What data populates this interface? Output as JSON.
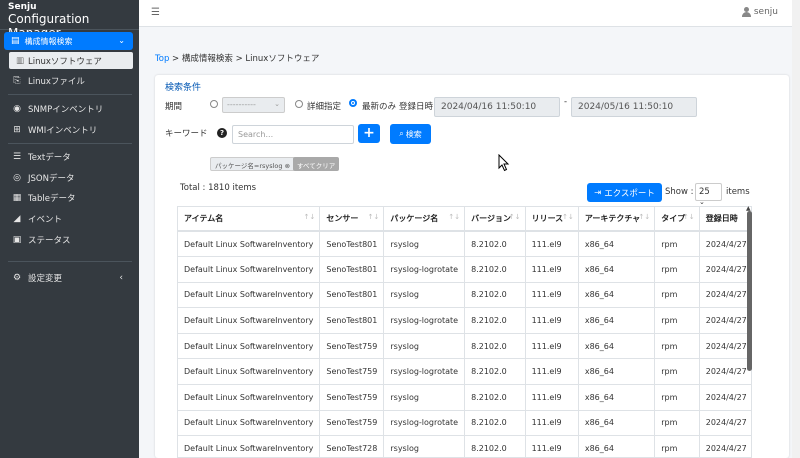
{
  "app": {
    "brand_line1": "Senju",
    "brand_line2": "Configuration Manager"
  },
  "sidebar": {
    "active_group": "構成情報検索",
    "active_sub": "Linuxソフトウェア",
    "items": [
      {
        "label": "Linuxファイル",
        "icon": "file-icon"
      },
      {
        "label": "SNMPインベントリ",
        "icon": "snmp-icon"
      },
      {
        "label": "WMIインベントリ",
        "icon": "windows-icon"
      },
      {
        "label": "Textデータ",
        "icon": "text-icon"
      },
      {
        "label": "JSONデータ",
        "icon": "json-icon"
      },
      {
        "label": "Tableデータ",
        "icon": "table-icon"
      },
      {
        "label": "イベント",
        "icon": "event-icon"
      },
      {
        "label": "ステータス",
        "icon": "status-icon"
      },
      {
        "label": "設定変更",
        "icon": "settings-icon"
      }
    ]
  },
  "topbar": {
    "user": "senju"
  },
  "breadcrumb": {
    "top": "Top",
    "level1": "構成情報検索",
    "level2": "Linuxソフトウェア"
  },
  "search": {
    "title": "検索条件",
    "period_label": "期間",
    "period_select": "----------",
    "detail_label": "詳細指定",
    "latest_label": "最新のみ",
    "registered_label": "登録日時",
    "date_from": "2024/04/16 11:50:10",
    "date_to": "2024/05/16 11:50:10",
    "date_sep": "-",
    "keyword_label": "キーワード",
    "keyword_placeholder": "Search...",
    "add_label": "+",
    "search_button": "検索",
    "chip": "パッケージ名=rsyslog",
    "clear_all": "すべてクリア"
  },
  "results": {
    "total": "Total : 1810 items",
    "export_button": "エクスポート",
    "show_label": "Show :",
    "page_size": "25",
    "items_label": "items"
  },
  "table": {
    "columns": [
      "アイテム名",
      "センサー",
      "パッケージ名",
      "バージョン",
      "リリース",
      "アーキテクチャ",
      "タイプ",
      "登録日時"
    ],
    "rows": [
      [
        "Default Linux SoftwareInventory",
        "SenoTest801",
        "rsyslog",
        "8.2102.0",
        "111.el9",
        "x86_64",
        "rpm",
        "2024/4/27"
      ],
      [
        "Default Linux SoftwareInventory",
        "SenoTest801",
        "rsyslog-logrotate",
        "8.2102.0",
        "111.el9",
        "x86_64",
        "rpm",
        "2024/4/27"
      ],
      [
        "Default Linux SoftwareInventory",
        "SenoTest801",
        "rsyslog",
        "8.2102.0",
        "111.el9",
        "x86_64",
        "rpm",
        "2024/4/27"
      ],
      [
        "Default Linux SoftwareInventory",
        "SenoTest801",
        "rsyslog-logrotate",
        "8.2102.0",
        "111.el9",
        "x86_64",
        "rpm",
        "2024/4/27"
      ],
      [
        "Default Linux SoftwareInventory",
        "SenoTest759",
        "rsyslog",
        "8.2102.0",
        "111.el9",
        "x86_64",
        "rpm",
        "2024/4/27"
      ],
      [
        "Default Linux SoftwareInventory",
        "SenoTest759",
        "rsyslog-logrotate",
        "8.2102.0",
        "111.el9",
        "x86_64",
        "rpm",
        "2024/4/27"
      ],
      [
        "Default Linux SoftwareInventory",
        "SenoTest759",
        "rsyslog",
        "8.2102.0",
        "111.el9",
        "x86_64",
        "rpm",
        "2024/4/27"
      ],
      [
        "Default Linux SoftwareInventory",
        "SenoTest759",
        "rsyslog-logrotate",
        "8.2102.0",
        "111.el9",
        "x86_64",
        "rpm",
        "2024/4/27"
      ],
      [
        "Default Linux SoftwareInventory",
        "SenoTest728",
        "rsyslog",
        "8.2102.0",
        "111.el9",
        "x86_64",
        "rpm",
        "2024/4/27"
      ]
    ]
  },
  "colors": {
    "primary": "#007bff",
    "sidebar": "#343a40"
  }
}
